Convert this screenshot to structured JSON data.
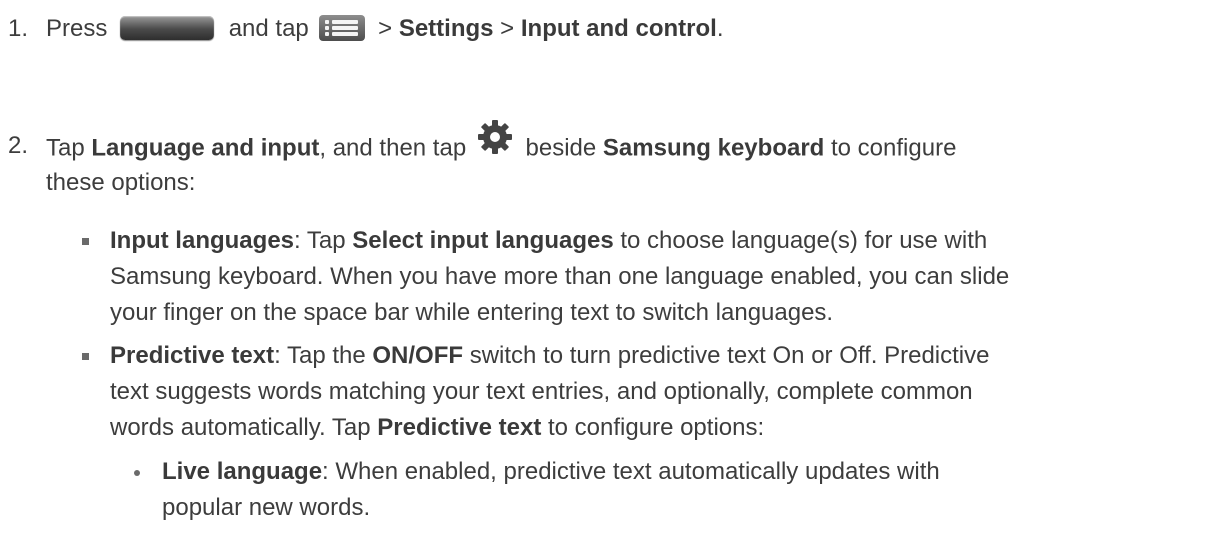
{
  "steps": [
    {
      "number": "1.",
      "parts": {
        "t1": "Press",
        "t2": "and tap",
        "t3": ">",
        "settings": "Settings",
        "t4": ">",
        "input_control": "Input and control",
        "t5": "."
      },
      "icons": [
        "home-key-icon",
        "menu-key-icon"
      ]
    },
    {
      "number": "2.",
      "parts": {
        "t1": "Tap",
        "lang_input": "Language and input",
        "t2": ", and then tap",
        "t3": "beside",
        "samsung_kb": "Samsung keyboard",
        "t4": "to configure",
        "line2": "these options:"
      },
      "icons": [
        "gear-icon"
      ]
    }
  ],
  "options": [
    {
      "title": "Input languages",
      "line1_a": ": Tap",
      "line1_b": "Select input languages",
      "line1_c": "to choose language(s) for use with",
      "line2": "Samsung keyboard. When you have more than one language enabled, you can slide",
      "line3": "your finger on the space bar while entering text to switch languages."
    },
    {
      "title": "Predictive text",
      "line1_a": ": Tap the",
      "line1_b": "ON/OFF",
      "line1_c": "switch to turn predictive text On or Off. Predictive",
      "line2": "text suggests words matching your text entries, and optionally, complete common",
      "line3_a": "words automatically. Tap",
      "line3_b": "Predictive text",
      "line3_c": "to configure options:"
    }
  ],
  "sub_options": [
    {
      "title": "Live language",
      "line1_a": ": When enabled, predictive text automatically updates with",
      "line2": "popular new words."
    }
  ],
  "colors": {
    "text": "#3d3d3d",
    "bullet": "#6a6a6a"
  }
}
